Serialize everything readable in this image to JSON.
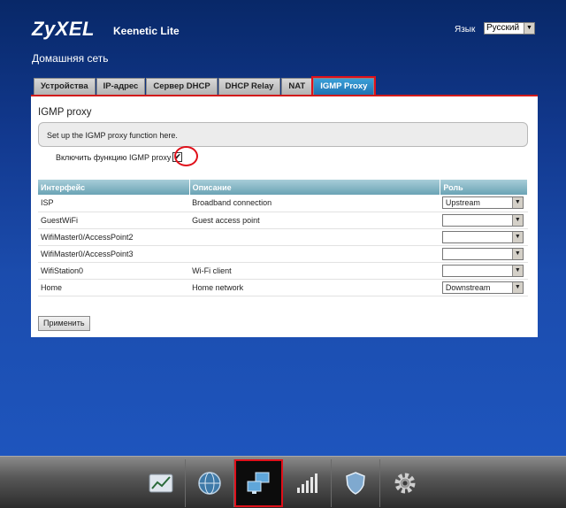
{
  "header": {
    "brand": "ZyXEL",
    "model": "Keenetic Lite",
    "language_label": "Язык",
    "language_value": "Русский"
  },
  "page": {
    "title": "Домашняя сеть"
  },
  "tabs": [
    {
      "label": "Устройства",
      "active": false
    },
    {
      "label": "IP-адрес",
      "active": false
    },
    {
      "label": "Сервер DHCP",
      "active": false
    },
    {
      "label": "DHCP Relay",
      "active": false
    },
    {
      "label": "NAT",
      "active": false
    },
    {
      "label": "IGMP Proxy",
      "active": true
    }
  ],
  "panel": {
    "heading": "IGMP proxy",
    "info": "Set up the IGMP proxy function here.",
    "enable_label": "Включить функцию IGMP proxy",
    "enable_checked": true,
    "checkbox_glyph": "✔",
    "columns": [
      "Интерфейс",
      "Описание",
      "Роль"
    ],
    "rows": [
      {
        "interface": "ISP",
        "description": "Broadband connection",
        "role": "Upstream"
      },
      {
        "interface": "GuestWiFi",
        "description": "Guest access point",
        "role": ""
      },
      {
        "interface": "WifiMaster0/AccessPoint2",
        "description": "",
        "role": ""
      },
      {
        "interface": "WifiMaster0/AccessPoint3",
        "description": "",
        "role": ""
      },
      {
        "interface": "WifiStation0",
        "description": "Wi-Fi client",
        "role": ""
      },
      {
        "interface": "Home",
        "description": "Home network",
        "role": "Downstream"
      }
    ],
    "apply_label": "Применить"
  },
  "taskbar": {
    "items": [
      {
        "icon": "chart-icon",
        "active": false
      },
      {
        "icon": "globe-icon",
        "active": false
      },
      {
        "icon": "network-icon",
        "active": true
      },
      {
        "icon": "signal-bars-icon",
        "active": false
      },
      {
        "icon": "shield-icon",
        "active": false
      },
      {
        "icon": "gear-icon",
        "active": false
      }
    ]
  },
  "colors": {
    "accent_red": "#e0101a",
    "tab_active": "#1d6fb0",
    "table_header": "#6aa3b5"
  }
}
